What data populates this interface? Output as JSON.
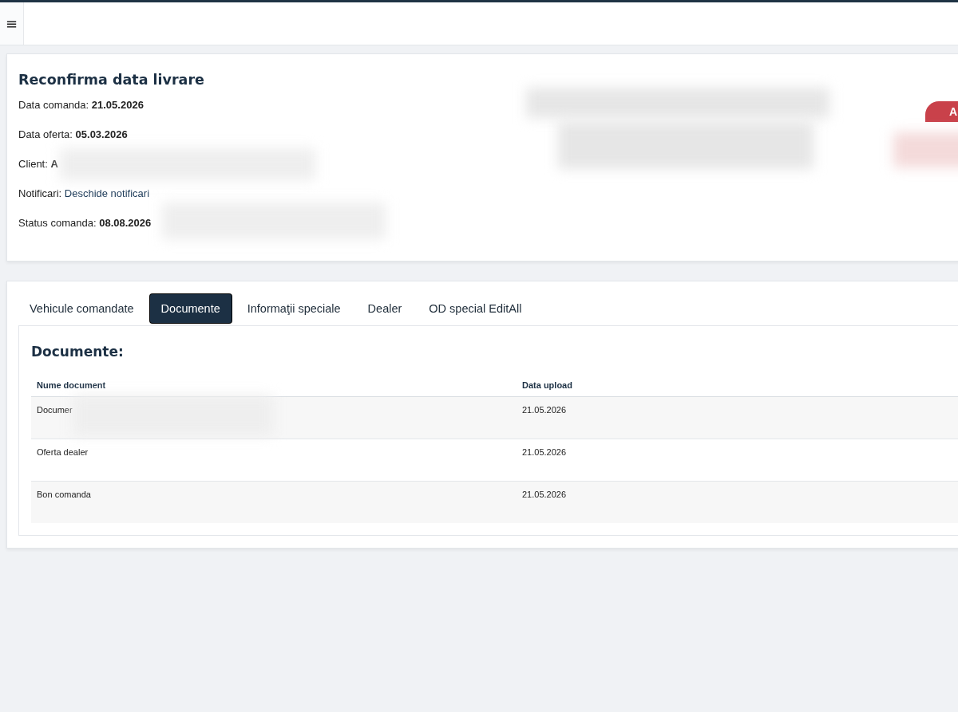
{
  "header": {
    "menu": "≡"
  },
  "order": {
    "title": "Reconfirma data livrare",
    "action_button": "A",
    "fields": [
      {
        "kind": "bold",
        "label": "Data comanda:",
        "value": "21.05.2026"
      },
      {
        "kind": "bold",
        "label": "Data oferta:",
        "value": "05.03.2026"
      },
      {
        "kind": "bold",
        "label": "Client:",
        "value": "A"
      },
      {
        "kind": "link",
        "label": "Notificari:",
        "value": "Deschide notificari"
      },
      {
        "kind": "bold",
        "label": "Status comanda:",
        "value": "08.08.2026"
      }
    ]
  },
  "tabs": [
    {
      "label": "Vehicule comandate",
      "selected": false
    },
    {
      "label": "Documente",
      "selected": true
    },
    {
      "label": "Informaţii speciale",
      "selected": false
    },
    {
      "label": "Dealer",
      "selected": false
    },
    {
      "label": "OD special EditAll",
      "selected": false
    }
  ],
  "documents": {
    "title": "Documente:",
    "columns": [
      "Nume document",
      "Data upload"
    ],
    "rows": [
      [
        "Documer",
        "21.05.2026"
      ],
      [
        "Oferta dealer",
        "21.05.2026"
      ],
      [
        "Bon comanda",
        "21.05.2026"
      ]
    ]
  }
}
